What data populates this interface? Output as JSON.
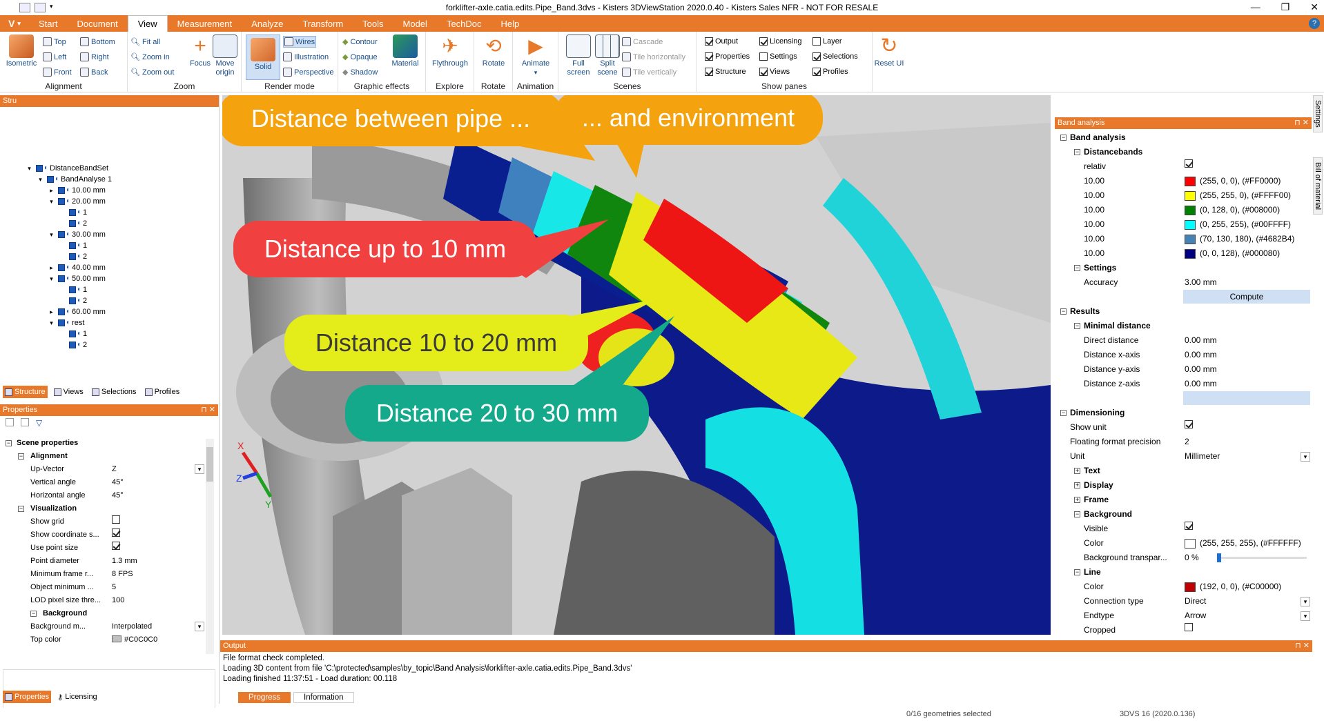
{
  "window": {
    "title": "forklifter-axle.catia.edits.Pipe_Band.3dvs - Kisters 3DViewStation 2020.0.40 - Kisters Sales NFR - NOT FOR RESALE",
    "logo": "V"
  },
  "menu": {
    "items": [
      "Start",
      "Document",
      "View",
      "Measurement",
      "Analyze",
      "Transform",
      "Tools",
      "Model",
      "TechDoc",
      "Help"
    ],
    "active": "View"
  },
  "ribbon": {
    "alignment": {
      "label": "Alignment",
      "big": "Isometric",
      "small": [
        "Top",
        "Bottom",
        "Left",
        "Right",
        "Front",
        "Back"
      ]
    },
    "zoom": {
      "label": "Zoom",
      "small": [
        "Fit all",
        "Zoom in",
        "Zoom out"
      ],
      "big": [
        "Focus",
        "Move origin"
      ]
    },
    "render": {
      "label": "Render mode",
      "big": "Solid",
      "small": [
        "Wires",
        "Illustration",
        "Perspective"
      ]
    },
    "effects": {
      "label": "Graphic effects",
      "small": [
        "Contour",
        "Opaque",
        "Shadow"
      ],
      "big": "Material"
    },
    "explore": {
      "label": "Explore",
      "big": "Flythrough"
    },
    "rotate": {
      "label": "Rotate",
      "big": "Rotate"
    },
    "animation": {
      "label": "Animation",
      "big": "Animate"
    },
    "scenes": {
      "label": "Scenes",
      "big": [
        "Full screen",
        "Split scene"
      ],
      "small": [
        "Cascade",
        "Tile horizontally",
        "Tile vertically"
      ]
    },
    "panes": {
      "label": "Show panes",
      "items": [
        {
          "label": "Output",
          "on": true
        },
        {
          "label": "Properties",
          "on": true
        },
        {
          "label": "Structure",
          "on": true
        },
        {
          "label": "Licensing",
          "on": true
        },
        {
          "label": "Settings",
          "on": false
        },
        {
          "label": "Views",
          "on": true
        },
        {
          "label": "Layer",
          "on": false
        },
        {
          "label": "Selections",
          "on": true
        },
        {
          "label": "Profiles",
          "on": true
        }
      ]
    },
    "reset": "Reset UI"
  },
  "structure": {
    "header": "Stru",
    "tree": [
      {
        "label": "DistanceBandSet",
        "depth": 1,
        "toggle": "minus"
      },
      {
        "label": "BandAnalyse  1",
        "depth": 2,
        "toggle": "minus"
      },
      {
        "label": "10.00 mm",
        "depth": 3,
        "toggle": "plus"
      },
      {
        "label": "20.00 mm",
        "depth": 3,
        "toggle": "minus"
      },
      {
        "label": "1",
        "depth": 4,
        "toggle": ""
      },
      {
        "label": "2",
        "depth": 4,
        "toggle": ""
      },
      {
        "label": "30.00 mm",
        "depth": 3,
        "toggle": "minus"
      },
      {
        "label": "1",
        "depth": 4,
        "toggle": ""
      },
      {
        "label": "2",
        "depth": 4,
        "toggle": ""
      },
      {
        "label": "40.00 mm",
        "depth": 3,
        "toggle": "plus"
      },
      {
        "label": "50.00 mm",
        "depth": 3,
        "toggle": "minus"
      },
      {
        "label": "1",
        "depth": 4,
        "toggle": ""
      },
      {
        "label": "2",
        "depth": 4,
        "toggle": ""
      },
      {
        "label": "60.00 mm",
        "depth": 3,
        "toggle": "plus"
      },
      {
        "label": "rest",
        "depth": 3,
        "toggle": "minus"
      },
      {
        "label": "1",
        "depth": 4,
        "toggle": ""
      },
      {
        "label": "2",
        "depth": 4,
        "toggle": ""
      }
    ],
    "tabs": [
      "Structure",
      "Views",
      "Selections",
      "Profiles"
    ]
  },
  "properties": {
    "header": "Properties",
    "rows": [
      {
        "type": "sec",
        "key": "Scene properties"
      },
      {
        "type": "sec2",
        "key": "Alignment"
      },
      {
        "type": "row",
        "key": "Up-Vector",
        "value": "Z",
        "dropdown": true
      },
      {
        "type": "row",
        "key": "Vertical angle",
        "value": "45°"
      },
      {
        "type": "row",
        "key": "Horizontal angle",
        "value": "45°"
      },
      {
        "type": "sec2",
        "key": "Visualization"
      },
      {
        "type": "row",
        "key": "Show grid",
        "check": false
      },
      {
        "type": "row",
        "key": "Show coordinate s...",
        "check": true
      },
      {
        "type": "row",
        "key": "Use point size",
        "check": true
      },
      {
        "type": "row",
        "key": "Point diameter",
        "value": "1.3 mm"
      },
      {
        "type": "row",
        "key": "Minimum frame r...",
        "value": "8 FPS"
      },
      {
        "type": "row",
        "key": "Object minimum ...",
        "value": "5"
      },
      {
        "type": "row",
        "key": "LOD pixel size thre...",
        "value": "100"
      },
      {
        "type": "sec3",
        "key": "Background"
      },
      {
        "type": "row",
        "key": "Background m...",
        "value": "Interpolated",
        "dropdown": true
      },
      {
        "type": "row",
        "key": "Top color",
        "value": "#C0C0C0",
        "swatch": "#C0C0C0"
      }
    ],
    "tabs": [
      "Properties",
      "Licensing"
    ]
  },
  "callouts": [
    {
      "text": "Distance between pipe ...",
      "color": "#f4a30e"
    },
    {
      "text": "... and environment",
      "color": "#f4a30e"
    },
    {
      "text": "Distance up to 10 mm",
      "color": "#f04040"
    },
    {
      "text": "Distance 10 to 20 mm",
      "color": "#e4ec1a"
    },
    {
      "text": "Distance 20 to 30 mm",
      "color": "#13a98a"
    }
  ],
  "axes": {
    "x": "X",
    "y": "Y",
    "z": "Z"
  },
  "band": {
    "header": "Band analysis",
    "rows": [
      {
        "t": "sec",
        "k": "Band analysis",
        "lvl": 0
      },
      {
        "t": "sec",
        "k": "Distancebands",
        "lvl": 1
      },
      {
        "t": "row",
        "k": "relativ",
        "check": true
      },
      {
        "t": "row",
        "k": "10.00",
        "v": "(255, 0, 0), (#FF0000)",
        "sw": "#FF0000"
      },
      {
        "t": "row",
        "k": "10.00",
        "v": "(255, 255, 0), (#FFFF00)",
        "sw": "#FFFF00"
      },
      {
        "t": "row",
        "k": "10.00",
        "v": "(0, 128, 0), (#008000)",
        "sw": "#008000"
      },
      {
        "t": "row",
        "k": "10.00",
        "v": "(0, 255, 255), (#00FFFF)",
        "sw": "#00FFFF"
      },
      {
        "t": "row",
        "k": "10.00",
        "v": "(70, 130, 180), (#4682B4)",
        "sw": "#4682B4"
      },
      {
        "t": "row",
        "k": "10.00",
        "v": "(0, 0, 128), (#000080)",
        "sw": "#000080"
      },
      {
        "t": "sec",
        "k": "Settings",
        "lvl": 1
      },
      {
        "t": "row",
        "k": "Accuracy",
        "v": "3.00 mm"
      },
      {
        "t": "btn",
        "v": "Compute"
      },
      {
        "t": "sec",
        "k": "Results",
        "lvl": 0
      },
      {
        "t": "sec",
        "k": "Minimal distance",
        "lvl": 1
      },
      {
        "t": "row",
        "k": "Direct distance",
        "v": "0.00 mm"
      },
      {
        "t": "row",
        "k": "Distance x-axis",
        "v": "0.00 mm"
      },
      {
        "t": "row",
        "k": "Distance y-axis",
        "v": "0.00 mm"
      },
      {
        "t": "row",
        "k": "Distance z-axis",
        "v": "0.00 mm"
      },
      {
        "t": "blank"
      },
      {
        "t": "sec",
        "k": "Dimensioning",
        "lvl": 0
      },
      {
        "t": "row0",
        "k": "Show unit",
        "check": true
      },
      {
        "t": "row0",
        "k": "Floating format precision",
        "v": "2"
      },
      {
        "t": "row0",
        "k": "Unit",
        "v": "Millimeter",
        "dd": true
      },
      {
        "t": "secp",
        "k": "Text",
        "lvl": 1
      },
      {
        "t": "secp",
        "k": "Display",
        "lvl": 1
      },
      {
        "t": "secp",
        "k": "Frame",
        "lvl": 1
      },
      {
        "t": "sec",
        "k": "Background",
        "lvl": 1
      },
      {
        "t": "row",
        "k": "Visible",
        "check": true
      },
      {
        "t": "row",
        "k": "Color",
        "v": "(255, 255, 255), (#FFFFFF)",
        "sw": "#FFFFFF"
      },
      {
        "t": "slider",
        "k": "Background transpar...",
        "v": "0 %",
        "level": 0
      },
      {
        "t": "sec",
        "k": "Line",
        "lvl": 1
      },
      {
        "t": "row",
        "k": "Color",
        "v": "(192, 0, 0), (#C00000)",
        "sw": "#C00000"
      },
      {
        "t": "row",
        "k": "Connection type",
        "v": "Direct",
        "dd": true
      },
      {
        "t": "row",
        "k": "Endtype",
        "v": "Arrow",
        "dd": true
      },
      {
        "t": "row",
        "k": "Cropped",
        "check": false
      }
    ]
  },
  "side_tabs": [
    "Settings",
    "Bill of material"
  ],
  "output": {
    "header": "Output",
    "lines": [
      "File format check completed.",
      "Loading 3D content from file 'C:\\protected\\samples\\by_topic\\Band Analysis\\forklifter-axle.catia.edits.Pipe_Band.3dvs'",
      "Loading finished 11:37:51 - Load duration: 00.118"
    ],
    "tabs": [
      "Progress",
      "Information"
    ]
  },
  "status": {
    "selected": "0/16 geometries selected",
    "version": "3DVS 16 (2020.0.136)"
  }
}
